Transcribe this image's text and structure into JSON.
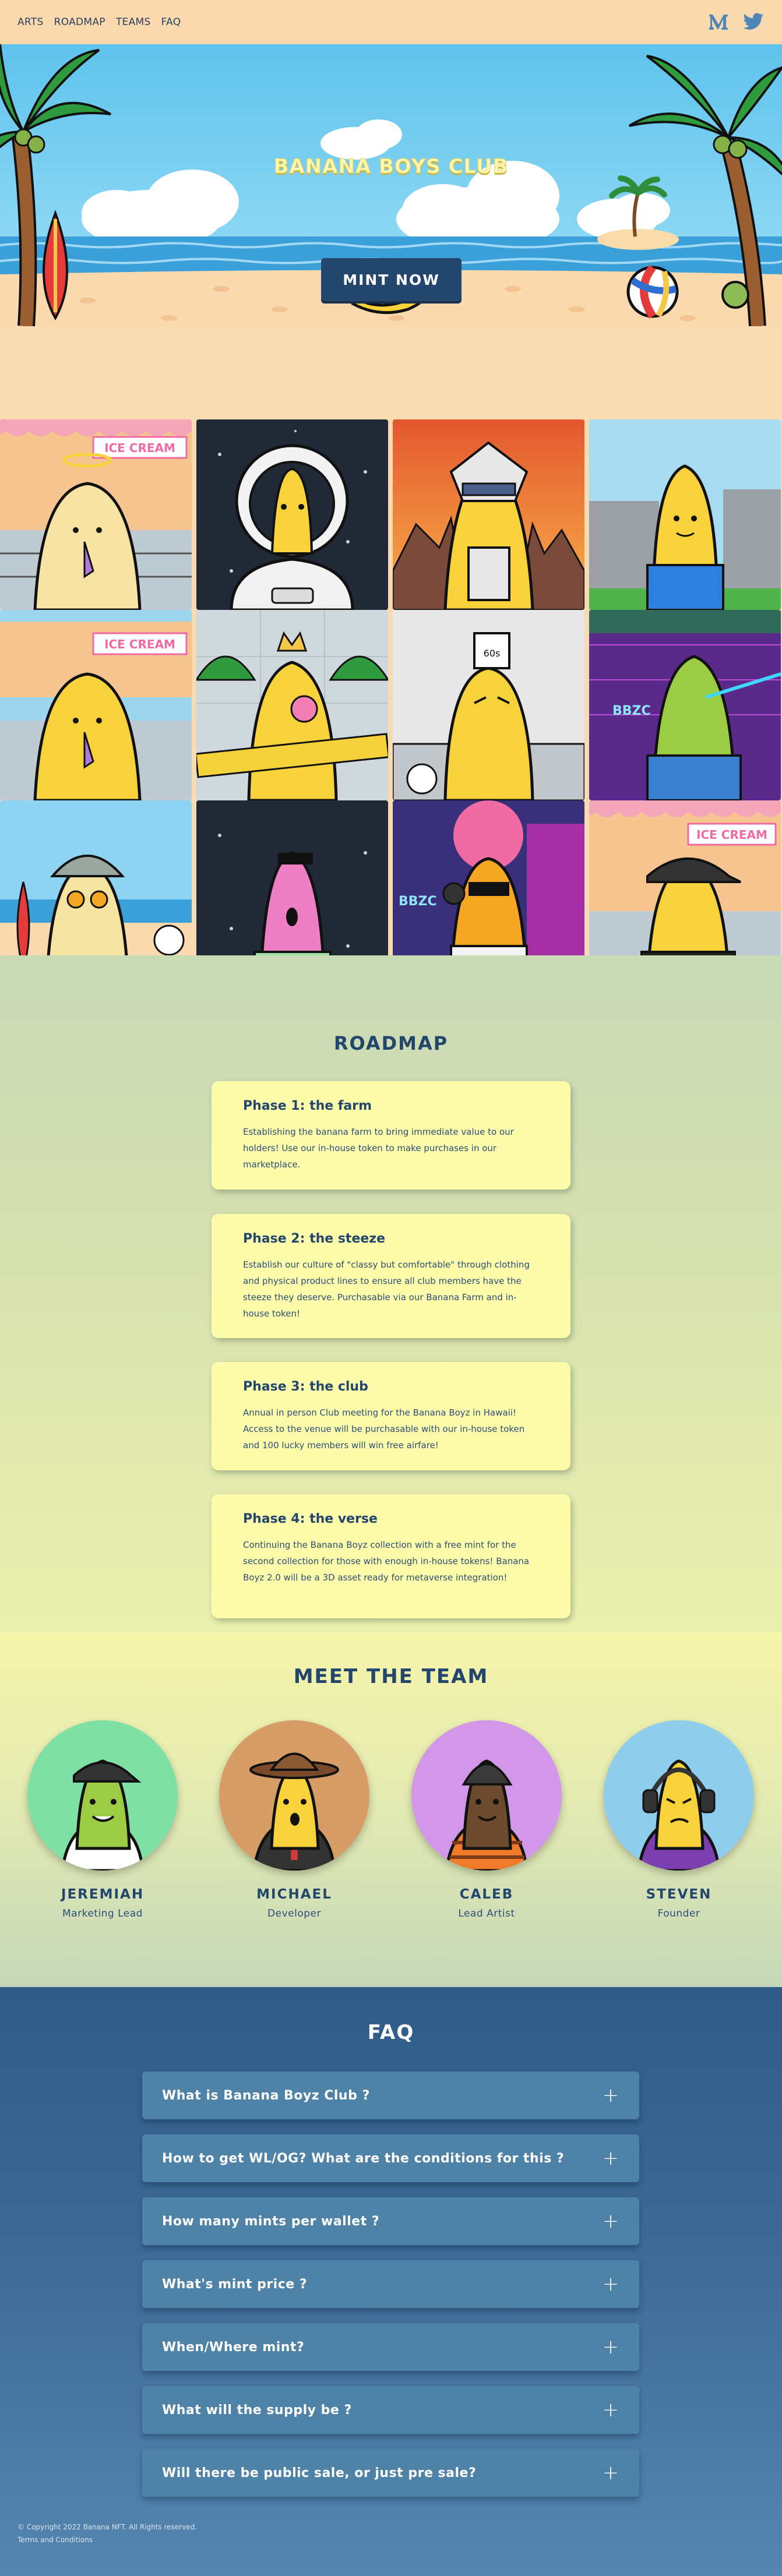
{
  "nav": {
    "links": [
      "ARTS",
      "ROADMAP",
      "TEAMS",
      "FAQ"
    ],
    "icons": [
      "medium-icon",
      "twitter-icon"
    ]
  },
  "hero": {
    "title": "BANANA BOYS CLUB",
    "mint_label": "MINT NOW"
  },
  "arts": {
    "tiles": [
      {
        "theme": "ice-cream-angel",
        "sign": "ICE CREAM"
      },
      {
        "theme": "astronaut"
      },
      {
        "theme": "robot-sunset"
      },
      {
        "theme": "pixel-castle"
      },
      {
        "theme": "ice-cream-angel-2",
        "sign": "ICE CREAM"
      },
      {
        "theme": "king-jungle"
      },
      {
        "theme": "chef-kitchen",
        "hat_label": "60s"
      },
      {
        "theme": "laser-cyber",
        "sign": "BBZC"
      },
      {
        "theme": "bucket-hat-beach"
      },
      {
        "theme": "pink-space"
      },
      {
        "theme": "dj-cyber",
        "sign": "BBZC"
      },
      {
        "theme": "cap-ice-cream",
        "sign": "ICE CREAM"
      }
    ]
  },
  "roadmap": {
    "title": "ROADMAP",
    "phases": [
      {
        "title": "Phase 1: the farm",
        "desc": "Establishing the banana farm to bring immediate value to our holders! Use our in-house token to make purchases in our marketplace."
      },
      {
        "title": "Phase 2: the steeze",
        "desc": "Establish our culture of \"classy but comfortable\" through clothing and physical product lines to ensure all club members have the steeze they deserve. Purchasable via our Banana Farm and in-house token!"
      },
      {
        "title": "Phase 3: the club",
        "desc": "Annual in person Club meeting for the Banana Boyz in Hawaii! Access to the venue will be purchasable with our in-house token and 100 lucky members will win free airfare!"
      },
      {
        "title": "Phase 4: the verse",
        "desc": "Continuing the Banana Boyz collection with a free mint for the second collection for those with enough in-house tokens! Banana Boyz 2.0 will be a 3D asset ready for metaverse integration!"
      }
    ]
  },
  "team": {
    "title": "MEET THE TEAM",
    "members": [
      {
        "name": "JEREMIAH",
        "role": "Marketing Lead",
        "bg": "#7fe0a6"
      },
      {
        "name": "MICHAEL",
        "role": "Developer",
        "bg": "#d69d66"
      },
      {
        "name": "CALEB",
        "role": "Lead Artist",
        "bg": "#d397ea"
      },
      {
        "name": "STEVEN",
        "role": "Founder",
        "bg": "#8fcdec"
      }
    ]
  },
  "faq": {
    "title": "FAQ",
    "items": [
      "What is Banana Boyz Club ?",
      "How to get WL/OG? What are the conditions for this ?",
      "How many mints per wallet ?",
      "What's mint price ?",
      "When/Where mint?",
      "What will the supply be ?",
      "Will there be public sale, or just pre sale?"
    ],
    "expand_symbol": "+"
  },
  "footer": {
    "copyright": "© Copyright 2022 Banana NFT. All Rights reserved.",
    "terms": "Terms and Conditions"
  },
  "colors": {
    "navy": "#23466d",
    "peach": "#fbd9ae",
    "card": "#fcfcaa",
    "faq_item": "#4e82a6"
  }
}
